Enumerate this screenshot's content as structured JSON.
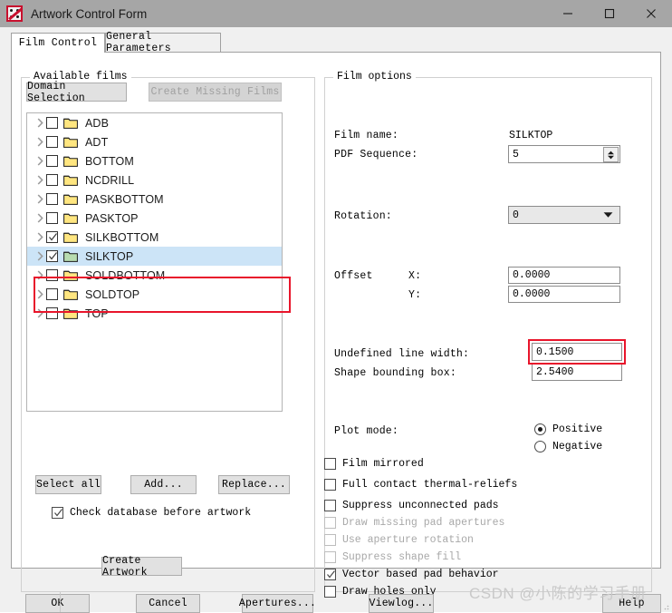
{
  "window": {
    "title": "Artwork Control Form",
    "icon": "artwork-app-icon",
    "minimize": "–",
    "maximize": "☐",
    "close": "✕"
  },
  "tabs": [
    {
      "label": "Film Control",
      "active": true
    },
    {
      "label": "General Parameters",
      "active": false
    }
  ],
  "available_films": {
    "group_title": "Available films",
    "domain_selection_label": "Domain Selection",
    "create_missing_films_label": "Create Missing Films",
    "create_missing_films_enabled": false,
    "rows": [
      {
        "name": "ADB",
        "checked": false,
        "selected": false
      },
      {
        "name": "ADT",
        "checked": false,
        "selected": false
      },
      {
        "name": "BOTTOM",
        "checked": false,
        "selected": false
      },
      {
        "name": "NCDRILL",
        "checked": false,
        "selected": false
      },
      {
        "name": "PASKBOTTOM",
        "checked": false,
        "selected": false
      },
      {
        "name": "PASKTOP",
        "checked": false,
        "selected": false
      },
      {
        "name": "SILKBOTTOM",
        "checked": true,
        "selected": false
      },
      {
        "name": "SILKTOP",
        "checked": true,
        "selected": true
      },
      {
        "name": "SOLDBOTTOM",
        "checked": false,
        "selected": false
      },
      {
        "name": "SOLDTOP",
        "checked": false,
        "selected": false
      },
      {
        "name": "TOP",
        "checked": false,
        "selected": false
      }
    ],
    "select_all_label": "Select all",
    "add_label": "Add...",
    "replace_label": "Replace...",
    "check_database_label": "Check database before artwork",
    "check_database_checked": true,
    "create_artwork_label": "Create Artwork"
  },
  "film_options": {
    "group_title": "Film options",
    "film_name_label": "Film name:",
    "film_name_value": "SILKTOP",
    "pdf_sequence_label": "PDF Sequence:",
    "pdf_sequence_value": "5",
    "rotation_label": "Rotation:",
    "rotation_value": "0",
    "offset_label": "Offset",
    "offset_x_label": "X:",
    "offset_x_value": "0.0000",
    "offset_y_label": "Y:",
    "offset_y_value": "0.0000",
    "undefined_line_width_label": "Undefined line width:",
    "undefined_line_width_value": "0.1500",
    "shape_bounding_box_label": "Shape bounding box:",
    "shape_bounding_box_value": "2.5400",
    "plot_mode_label": "Plot mode:",
    "plot_mode_options": [
      {
        "label": "Positive",
        "selected": true
      },
      {
        "label": "Negative",
        "selected": false
      }
    ],
    "checkboxes": [
      {
        "label": "Film mirrored",
        "checked": false,
        "enabled": true
      },
      {
        "label": "Full contact thermal-reliefs",
        "checked": false,
        "enabled": true
      },
      {
        "label": "Suppress unconnected pads",
        "checked": false,
        "enabled": true
      },
      {
        "label": "Draw missing pad apertures",
        "checked": false,
        "enabled": false
      },
      {
        "label": "Use aperture rotation",
        "checked": false,
        "enabled": false
      },
      {
        "label": "Suppress shape fill",
        "checked": false,
        "enabled": false
      },
      {
        "label": "Vector based pad behavior",
        "checked": true,
        "enabled": true
      },
      {
        "label": "Draw holes only",
        "checked": false,
        "enabled": true
      }
    ]
  },
  "footer": {
    "ok_label": "OK",
    "cancel_label": "Cancel",
    "apertures_label": "Apertures...",
    "viewlog_label": "Viewlog...",
    "help_label": "Help"
  },
  "watermark": "CSDN @小陈的学习手册",
  "colors": {
    "titlebar": "#a6a6a6",
    "dialog_bg": "#f0f0f0",
    "selection_blue": "#cce4f7",
    "annotation_red": "#e8152b",
    "folder_yellow": "#ffe680",
    "folder_green": "#b8dcb0"
  }
}
